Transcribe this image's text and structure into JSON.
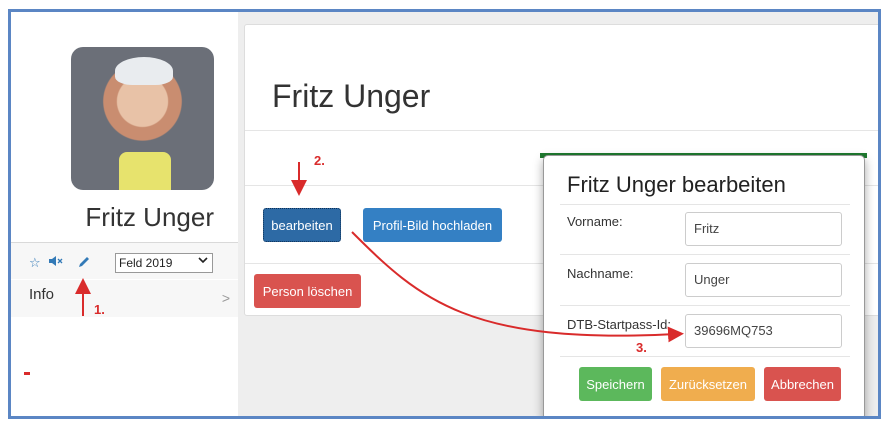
{
  "profile": {
    "name": "Fritz Unger",
    "select_value": "Feld 2019",
    "info_label": "Info",
    "info_chevron": ">"
  },
  "toolbar_icons": [
    "star-icon",
    "mute-icon",
    "pencil-icon"
  ],
  "main": {
    "title": "Fritz Unger",
    "edit_button": "bearbeiten",
    "upload_button": "Profil-Bild hochladen",
    "delete_button": "Person löschen"
  },
  "modal": {
    "title": "Fritz Unger bearbeiten",
    "fields": [
      {
        "label": "Vorname:",
        "value": "Fritz"
      },
      {
        "label": "Nachname:",
        "value": "Unger"
      },
      {
        "label": "DTB-Startpass-Id:",
        "value": "39696MQ753"
      }
    ],
    "save_button": "Speichern",
    "reset_button": "Zurücksetzen",
    "cancel_button": "Abbrechen"
  },
  "annotations": {
    "step1": "1.",
    "step2": "2.",
    "step3": "3."
  },
  "colors": {
    "frame": "#5b86c4",
    "primary": "#3480c4",
    "danger": "#d9534f",
    "success": "#5cb85c",
    "warning": "#f0ad4e",
    "annotation": "#d92b2b"
  }
}
